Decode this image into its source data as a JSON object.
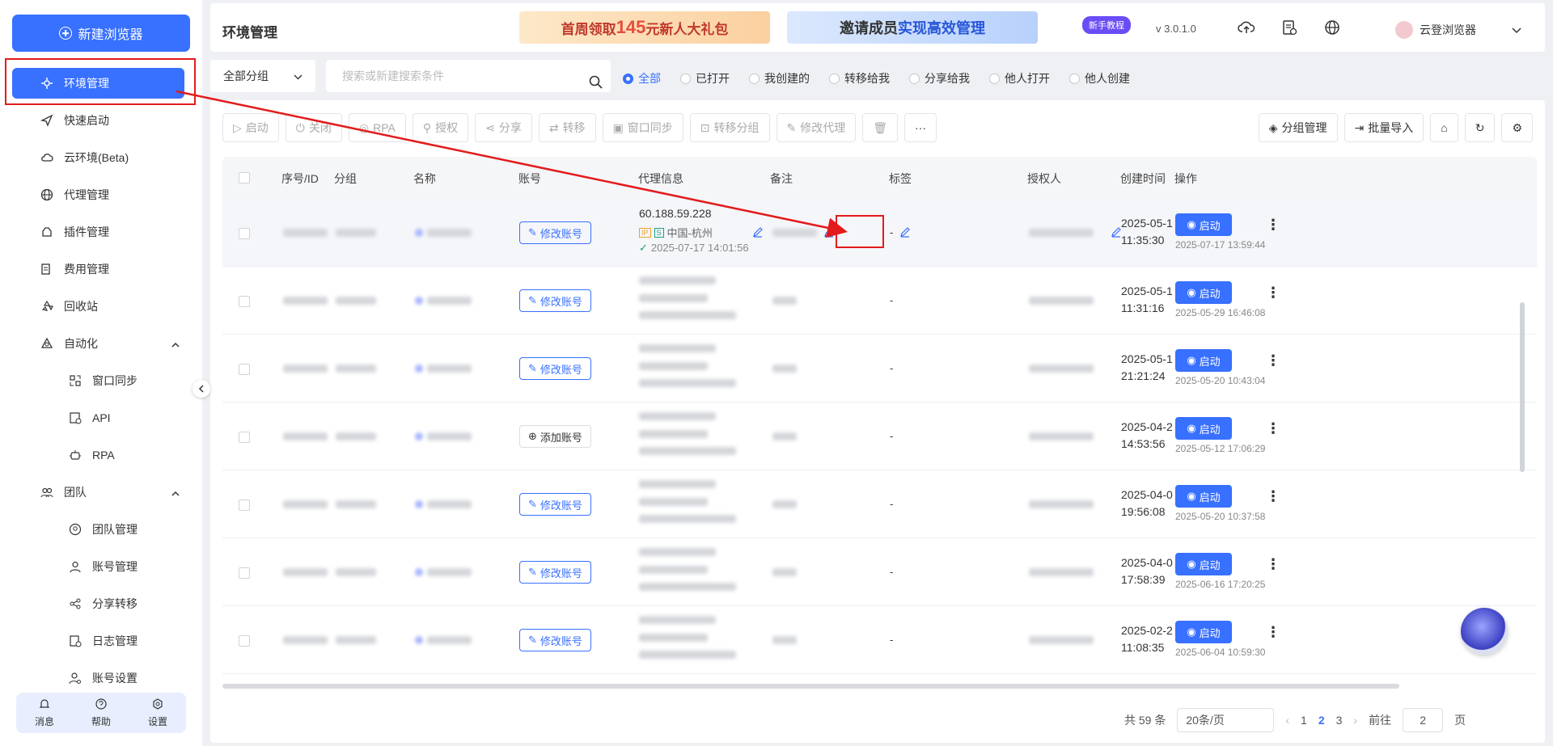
{
  "sidebar": {
    "new_browser": "新建浏览器",
    "items": [
      {
        "label": "环境管理",
        "icon": "environment-icon",
        "active": true
      },
      {
        "label": "快速启动",
        "icon": "send-icon"
      },
      {
        "label": "云环境(Beta)",
        "icon": "cloud-icon"
      },
      {
        "label": "代理管理",
        "icon": "globe-icon"
      },
      {
        "label": "插件管理",
        "icon": "plugin-icon"
      },
      {
        "label": "费用管理",
        "icon": "bill-icon"
      },
      {
        "label": "回收站",
        "icon": "recycle-icon"
      },
      {
        "label": "自动化",
        "icon": "automation-icon",
        "expanded": true
      },
      {
        "label": "窗口同步",
        "icon": "window-sync-icon",
        "sub": true
      },
      {
        "label": "API",
        "icon": "api-icon",
        "sub": true
      },
      {
        "label": "RPA",
        "icon": "robot-icon",
        "sub": true
      },
      {
        "label": "团队",
        "icon": "team-icon",
        "expanded": true
      },
      {
        "label": "团队管理",
        "icon": "team-manage-icon",
        "sub": true
      },
      {
        "label": "账号管理",
        "icon": "user-icon",
        "sub": true
      },
      {
        "label": "分享转移",
        "icon": "share-icon",
        "sub": true
      },
      {
        "label": "日志管理",
        "icon": "log-icon",
        "sub": true
      },
      {
        "label": "账号设置",
        "icon": "account-settings-icon",
        "sub": true
      }
    ],
    "bottom": {
      "messages": "消息",
      "help": "帮助",
      "settings": "设置"
    }
  },
  "header": {
    "title": "环境管理",
    "banner1": {
      "pre": "首周领取",
      "num": "145",
      "post": "元新人大礼包"
    },
    "banner2": {
      "pre": "邀请成员",
      "post": "实现高效管理"
    },
    "tutorial": "新手教程",
    "version": "v 3.0.1.0",
    "user": "云登浏览器"
  },
  "filters": {
    "group": "全部分组",
    "search_placeholder": "搜索或新建搜索条件",
    "radios": [
      "全部",
      "已打开",
      "我创建的",
      "转移给我",
      "分享给我",
      "他人打开",
      "他人创建"
    ],
    "selected": "全部"
  },
  "toolbar": {
    "left": [
      "启动",
      "关闭",
      "RPA",
      "授权",
      "分享",
      "转移",
      "窗口同步",
      "转移分组",
      "修改代理",
      "",
      "···"
    ],
    "right": [
      "分组管理",
      "批量导入"
    ]
  },
  "table": {
    "columns": [
      "序号/ID",
      "分组",
      "名称",
      "账号",
      "代理信息",
      "备注",
      "标签",
      "授权人",
      "创建时间",
      "操作"
    ],
    "rows": [
      {
        "account": "修改账号",
        "proxy_ip": "60.188.59.228",
        "proxy_loc": "中国-杭州",
        "proxy_time": "2025-07-17 14:01:56",
        "tag": "-",
        "created": [
          "2025-05-1",
          "11:35:30"
        ],
        "date2": "2025-07-17 13:59:44",
        "start": "启动"
      },
      {
        "account": "修改账号",
        "tag": "-",
        "created": [
          "2025-05-1",
          "11:31:16"
        ],
        "date2": "2025-05-29 16:46:08",
        "start": "启动"
      },
      {
        "account": "修改账号",
        "tag": "-",
        "created": [
          "2025-05-1",
          "21:21:24"
        ],
        "date2": "2025-05-20 10:43:04",
        "start": "启动"
      },
      {
        "account": "添加账号",
        "tag": "-",
        "created": [
          "2025-04-2",
          "14:53:56"
        ],
        "date2": "2025-05-12 17:06:29",
        "start": "启动"
      },
      {
        "account": "修改账号",
        "tag": "-",
        "created": [
          "2025-04-0",
          "19:56:08"
        ],
        "date2": "2025-05-20 10:37:58",
        "start": "启动"
      },
      {
        "account": "修改账号",
        "tag": "-",
        "created": [
          "2025-04-0",
          "17:58:39"
        ],
        "date2": "2025-06-16 17:20:25",
        "start": "启动"
      },
      {
        "account": "修改账号",
        "tag": "-",
        "created": [
          "2025-02-2",
          "11:08:35"
        ],
        "date2": "2025-06-04 10:59:30",
        "start": "启动"
      }
    ]
  },
  "pagination": {
    "total": "共 59 条",
    "per_page": "20条/页",
    "pages": [
      "1",
      "2",
      "3"
    ],
    "current": "2",
    "goto": "前往",
    "goto_value": "2",
    "page_suffix": "页"
  },
  "colors": {
    "accent": "#3870ff",
    "annotation": "#e31b1b"
  }
}
